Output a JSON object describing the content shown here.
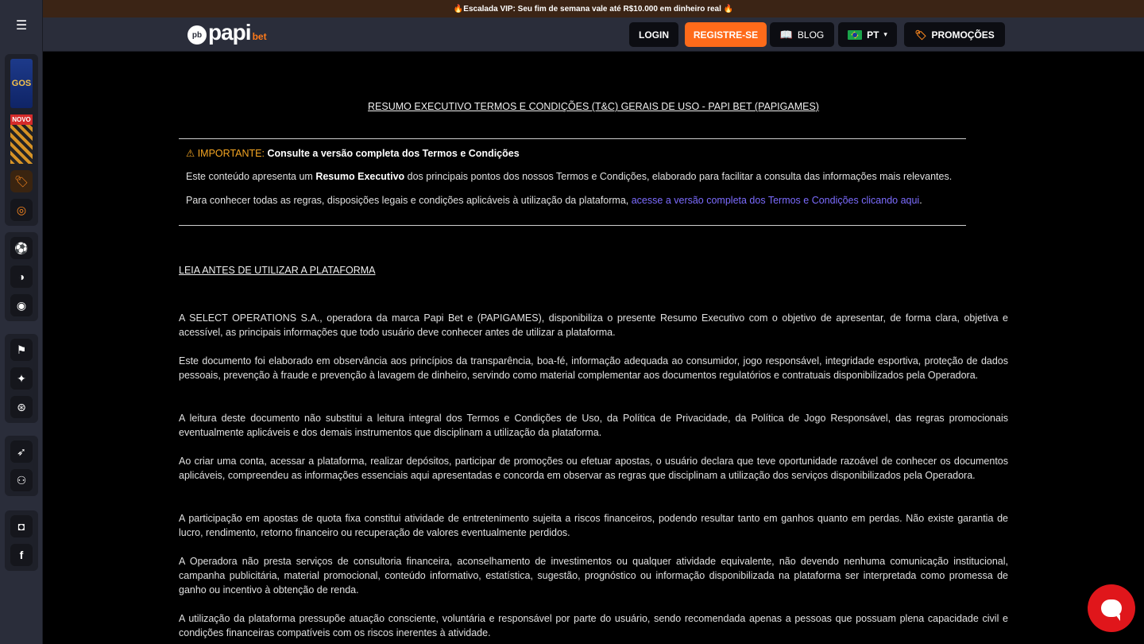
{
  "promo_strip": "🔥Escalada VIP: Seu fim de semana vale até R$10.000 em dinheiro real 🔥",
  "header": {
    "logo_badge": "pb",
    "logo_text": "papi",
    "logo_suffix": "bet",
    "login": "LOGIN",
    "register": "REGISTRE-SE",
    "blog": "BLOG",
    "lang": "PT",
    "promotions": "PROMOÇÕES"
  },
  "rail": {
    "tile1_label": "GOS",
    "tile2_badge": "NOVO"
  },
  "doc": {
    "title": "RESUMO EXECUTIVO TERMOS E CONDIÇÕES (T&C) GERAIS DE USO - PAPI BET (PAPIGAMES)",
    "important_prefix": "IMPORTANTE:",
    "important_text": "Consulte a versão completa dos Termos e Condições",
    "summary_before": "Este conteúdo apresenta um ",
    "summary_bold": "Resumo Executivo",
    "summary_after": " dos principais pontos dos nossos Termos e Condições, elaborado para facilitar a consulta das informações mais relevantes.",
    "rules_before": "Para conhecer todas as regras, disposições legais e condições aplicáveis à utilização da plataforma, ",
    "rules_link": "acesse a versão completa dos Termos e Condições clicando aqui",
    "rules_after": ".",
    "section_title": "LEIA ANTES DE UTILIZAR A PLATAFORMA",
    "paragraphs": [
      "A SELECT OPERATIONS S.A., operadora da marca Papi Bet e (PAPIGAMES), disponibiliza o presente Resumo Executivo com o objetivo de apresentar, de forma clara, objetiva e acessível, as principais informações que todo usuário deve conhecer antes de utilizar a plataforma.",
      "Este documento foi elaborado em observância aos princípios da transparência, boa-fé, informação adequada ao consumidor, jogo responsável, integridade esportiva, proteção de dados pessoais, prevenção à fraude e prevenção à lavagem de dinheiro, servindo como material complementar aos documentos regulatórios e contratuais disponibilizados pela Operadora.",
      "A leitura deste documento não substitui a leitura integral dos Termos e Condições de Uso, da Política de Privacidade, da Política de Jogo Responsável, das regras promocionais eventualmente aplicáveis e dos demais instrumentos que disciplinam a utilização da plataforma.",
      "Ao criar uma conta, acessar a plataforma, realizar depósitos, participar de promoções ou efetuar apostas, o usuário declara que teve oportunidade razoável de conhecer os documentos aplicáveis, compreendeu as informações essenciais aqui apresentadas e concorda em observar as regras que disciplinam a utilização dos serviços disponibilizados pela Operadora.",
      "A participação em apostas de quota fixa constitui atividade de entretenimento sujeita a riscos financeiros, podendo resultar tanto em ganhos quanto em perdas. Não existe garantia de lucro, rendimento, retorno financeiro ou recuperação de valores eventualmente perdidos.",
      "A Operadora não presta serviços de consultoria financeira, aconselhamento de investimentos ou qualquer atividade equivalente, não devendo nenhuma comunicação institucional, campanha publicitária, material promocional, conteúdo informativo, estatística, sugestão, prognóstico ou informação disponibilizada na plataforma ser interpretada como promessa de ganho ou incentivo à obtenção de renda.",
      "A utilização da plataforma pressupõe atuação consciente, voluntária e responsável por parte do usuário, sendo recomendada apenas a pessoas que possuam plena capacidade civil e condições financeiras compatíveis com os riscos inerentes à atividade."
    ]
  }
}
